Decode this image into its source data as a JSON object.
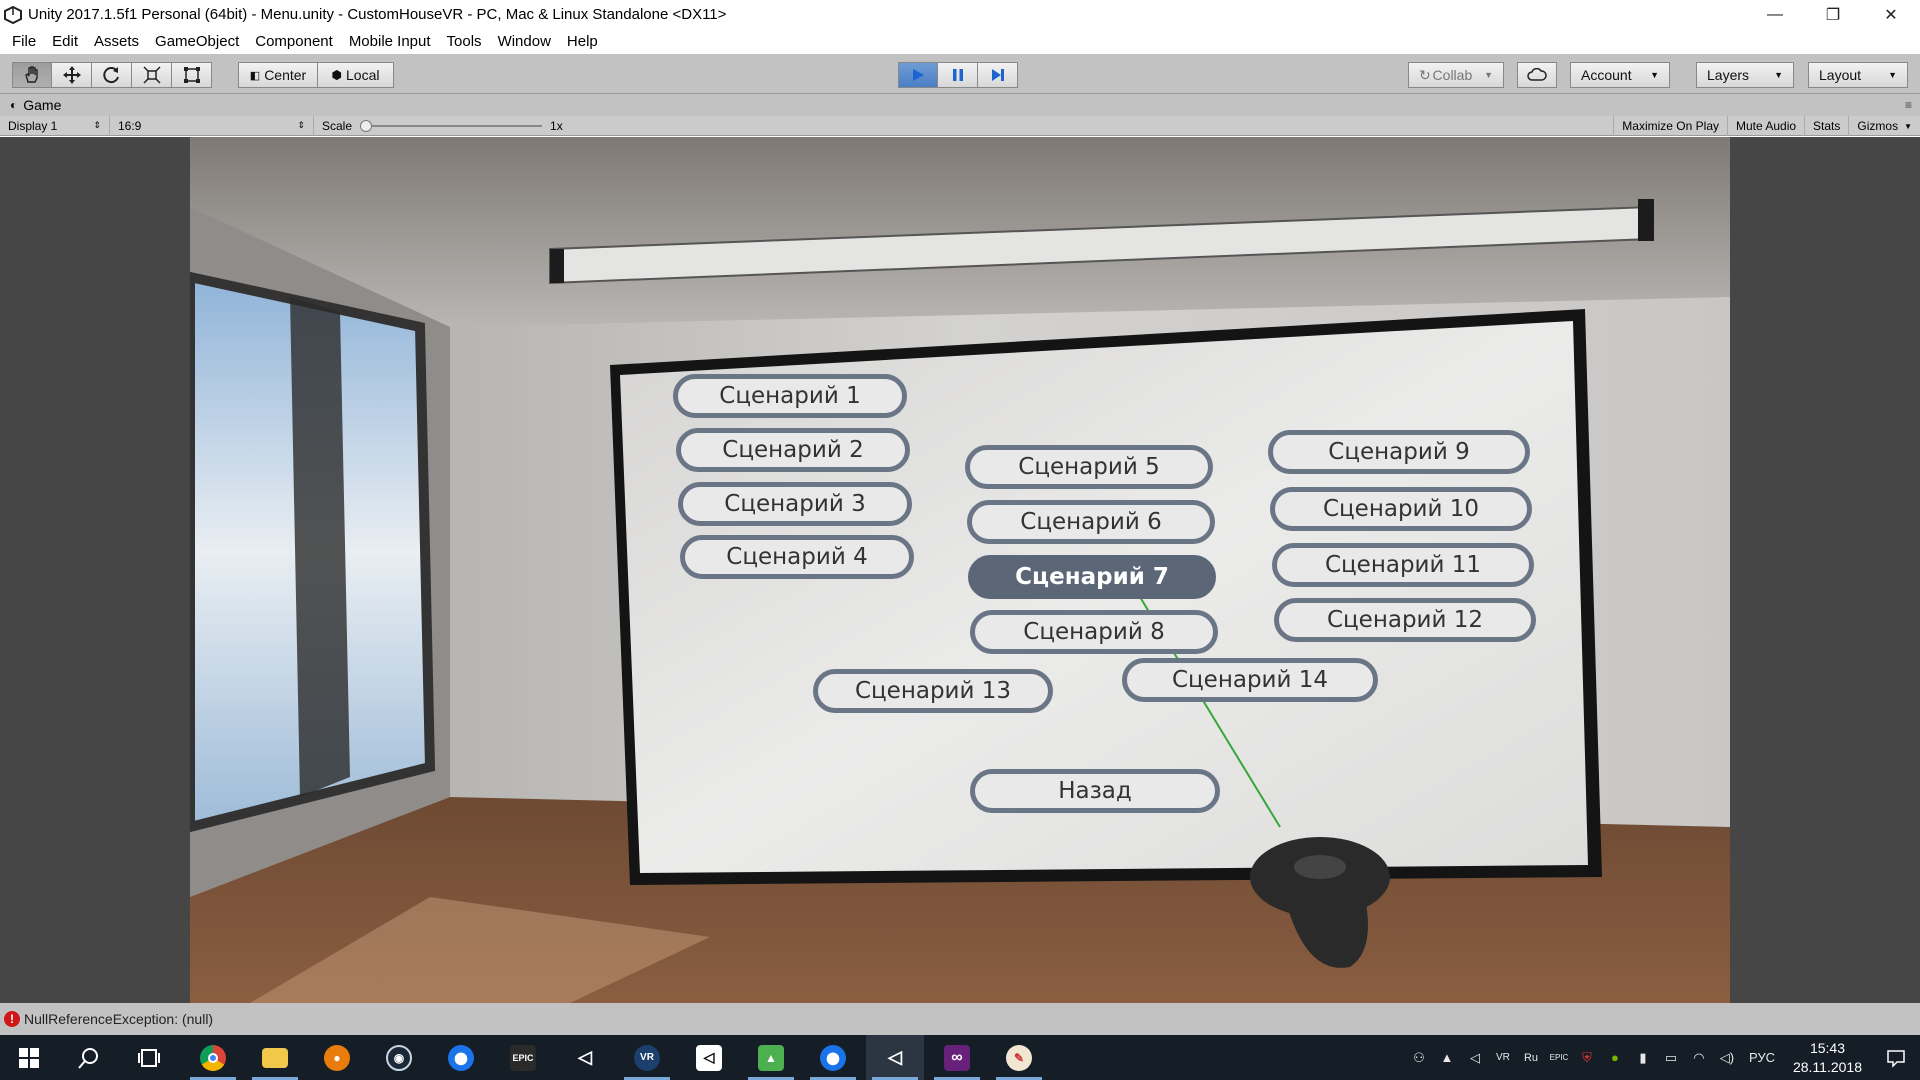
{
  "window": {
    "title": "Unity 2017.1.5f1 Personal (64bit) - Menu.unity - CustomHouseVR - PC, Mac & Linux Standalone <DX11>",
    "minimize": "—",
    "restore": "❐",
    "close": "✕"
  },
  "menu": [
    "File",
    "Edit",
    "Assets",
    "GameObject",
    "Component",
    "Mobile Input",
    "Tools",
    "Window",
    "Help"
  ],
  "toolbar": {
    "transform_tools": [
      "hand-icon",
      "move-icon",
      "rotate-icon",
      "scale-icon",
      "rect-icon"
    ],
    "pivot": "Center",
    "space": "Local",
    "collab": "Collab",
    "account": "Account",
    "layers": "Layers",
    "layout": "Layout"
  },
  "game_view": {
    "tab_label": "Game",
    "display": "Display 1",
    "aspect": "16:9",
    "scale_label": "Scale",
    "scale_value": "1x",
    "maximize": "Maximize On Play",
    "mute": "Mute Audio",
    "stats": "Stats",
    "gizmos": "Gizmos"
  },
  "scene_menu": {
    "buttons": [
      "Сценарий 1",
      "Сценарий 2",
      "Сценарий 3",
      "Сценарий 4",
      "Сценарий 5",
      "Сценарий 6",
      "Сценарий 7",
      "Сценарий 8",
      "Сценарий 9",
      "Сценарий 10",
      "Сценарий 11",
      "Сценарий 12",
      "Сценарий 13",
      "Сценарий 14"
    ],
    "selected": "Сценарий 7",
    "back": "Назад"
  },
  "status": {
    "message": "NullReferenceException: (null)"
  },
  "taskbar": {
    "apps": [
      "chrome-icon",
      "file-explorer-icon",
      "blender-icon",
      "steam-icon",
      "maps-icon",
      "epic-games-icon",
      "unity-icon",
      "vr-icon",
      "unity-hub-icon",
      "image-editor-icon",
      "maps-icon",
      "unity-icon",
      "visual-studio-icon",
      "paint-icon"
    ],
    "language": "РУС",
    "time": "15:43",
    "date": "28.11.2018"
  },
  "colors": {
    "unity_chrome": "#c2c2c2",
    "play_active": "#4b7fc4",
    "button_border": "#6a7686",
    "taskbar": "#151d27",
    "error": "#d01616"
  }
}
